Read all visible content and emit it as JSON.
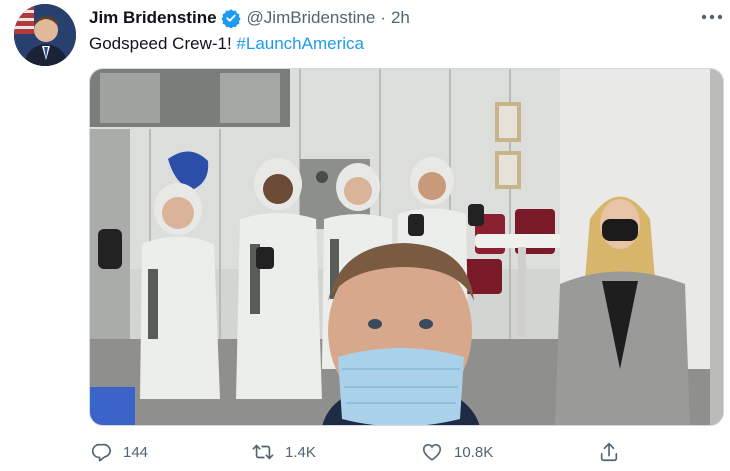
{
  "tweet": {
    "author": {
      "display_name": "Jim Bridenstine",
      "handle": "@JimBridenstine",
      "verified_icon": "verified-badge-icon",
      "avatar_icon": "avatar"
    },
    "separator": "·",
    "time": "2h",
    "text_prefix": "Godspeed Crew-1! ",
    "hashtag": "#LaunchAmerica",
    "more_icon": "more-options-icon",
    "media": {
      "description_icon": "photo"
    },
    "actions": {
      "reply": {
        "icon": "reply-icon",
        "count": "144"
      },
      "retweet": {
        "icon": "retweet-icon",
        "count": "1.4K"
      },
      "like": {
        "icon": "heart-icon",
        "count": "10.8K"
      },
      "share": {
        "icon": "share-icon"
      }
    }
  },
  "colors": {
    "accent": "#1d9bf0",
    "text_primary": "#0f1419",
    "text_secondary": "#536471",
    "border": "#cfd9de"
  }
}
